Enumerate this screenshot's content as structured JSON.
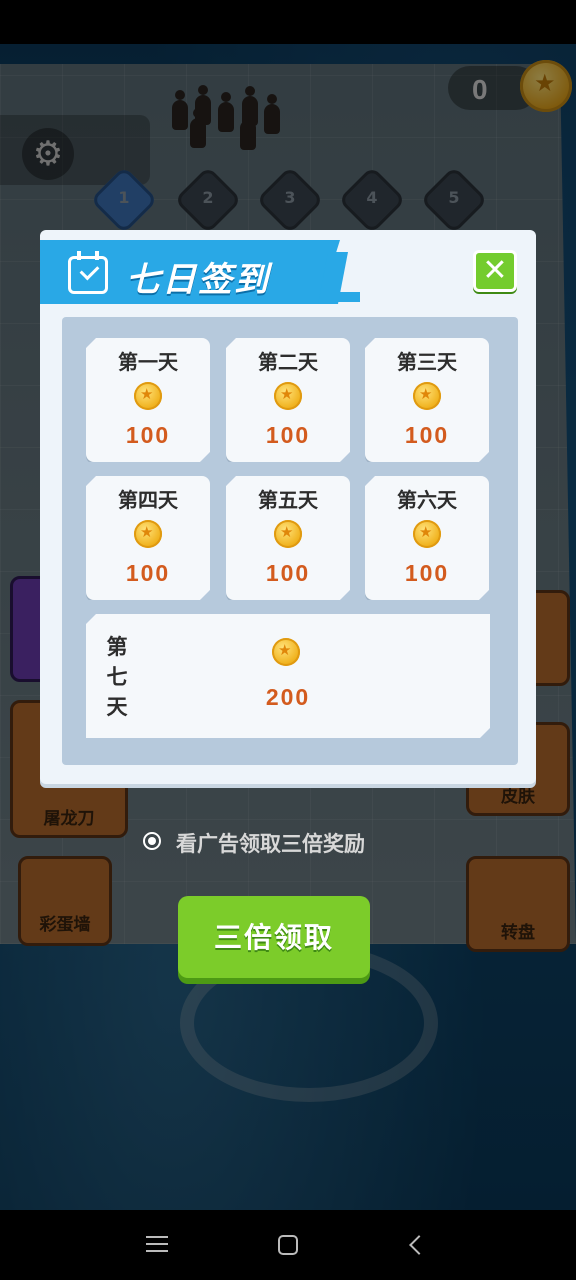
{
  "hud": {
    "coins": "0"
  },
  "levels": [
    "1",
    "2",
    "3",
    "4",
    "5"
  ],
  "side_buttons": {
    "left_mid": "屠龙刀",
    "left_bottom": "彩蛋墙",
    "right_mid": "皮肤",
    "right_bottom": "转盘"
  },
  "dialog": {
    "title": "七日签到",
    "close_icon": "close-x",
    "days": [
      {
        "label": "第一天",
        "reward": "100"
      },
      {
        "label": "第二天",
        "reward": "100"
      },
      {
        "label": "第三天",
        "reward": "100"
      },
      {
        "label": "第四天",
        "reward": "100"
      },
      {
        "label": "第五天",
        "reward": "100"
      },
      {
        "label": "第六天",
        "reward": "100"
      }
    ],
    "day7": {
      "chars": [
        "第",
        "七",
        "天"
      ],
      "reward": "200"
    }
  },
  "ad_option": {
    "label": "看广告领取三倍奖励",
    "selected": true
  },
  "claim_button": {
    "label": "三倍领取"
  },
  "colors": {
    "accent_blue": "#29a8e6",
    "accent_green": "#74cc2e",
    "reward_orange": "#d35b1e"
  }
}
